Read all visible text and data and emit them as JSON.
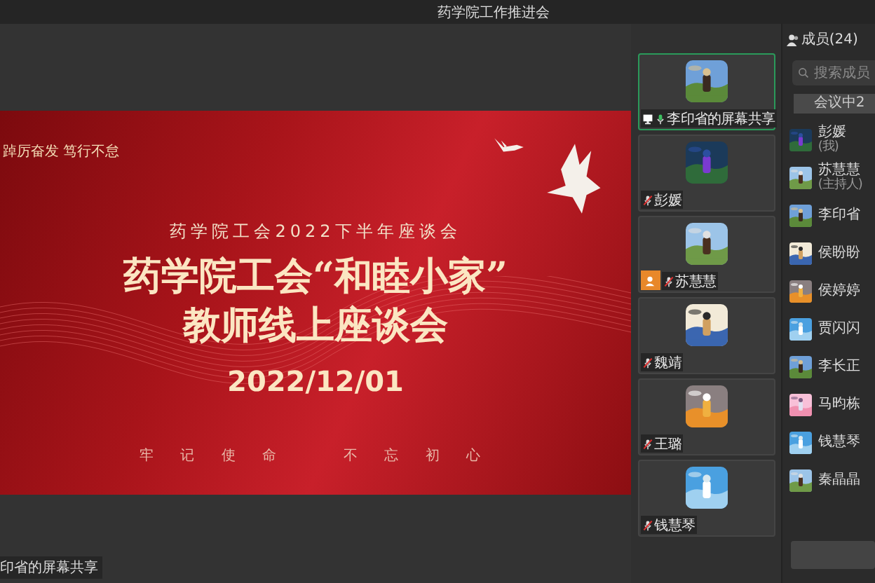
{
  "window": {
    "title": "药学院工作推进会"
  },
  "slide": {
    "motto": "踔厉奋发 笃行不怠",
    "subtitle": "药学院工会2022下半年座谈会",
    "title_lines": [
      "药学院工会“和睦小家”",
      "教师线上座谈会"
    ],
    "date": "2022/12/01",
    "slogans": [
      "牢 记 使 命",
      "不 忘 初 心"
    ]
  },
  "share_label": "印省的屏幕共享",
  "video_tiles": [
    {
      "name": "李印省的屏幕共享",
      "selected": true,
      "sharing": true,
      "muted": false,
      "host": false
    },
    {
      "name": "彭媛",
      "selected": false,
      "sharing": false,
      "muted": true,
      "host": false
    },
    {
      "name": "苏慧慧",
      "selected": false,
      "sharing": false,
      "muted": true,
      "host": true
    },
    {
      "name": "魏靖",
      "selected": false,
      "sharing": false,
      "muted": true,
      "host": false
    },
    {
      "name": "王璐",
      "selected": false,
      "sharing": false,
      "muted": true,
      "host": false
    },
    {
      "name": "钱慧琴",
      "selected": false,
      "sharing": false,
      "muted": true,
      "host": false
    }
  ],
  "members_panel": {
    "title": "成员(24)",
    "search_placeholder": "搜索成员",
    "tab": "会议中2",
    "members": [
      {
        "name": "彭媛",
        "role": "(我)"
      },
      {
        "name": "苏慧慧",
        "role": "(主持人)"
      },
      {
        "name": "李印省"
      },
      {
        "name": "侯盼盼"
      },
      {
        "name": "侯婷婷"
      },
      {
        "name": "贾闪闪"
      },
      {
        "name": "李长正"
      },
      {
        "name": "马昀栋"
      },
      {
        "name": "钱慧琴"
      },
      {
        "name": "秦晶晶"
      }
    ]
  }
}
